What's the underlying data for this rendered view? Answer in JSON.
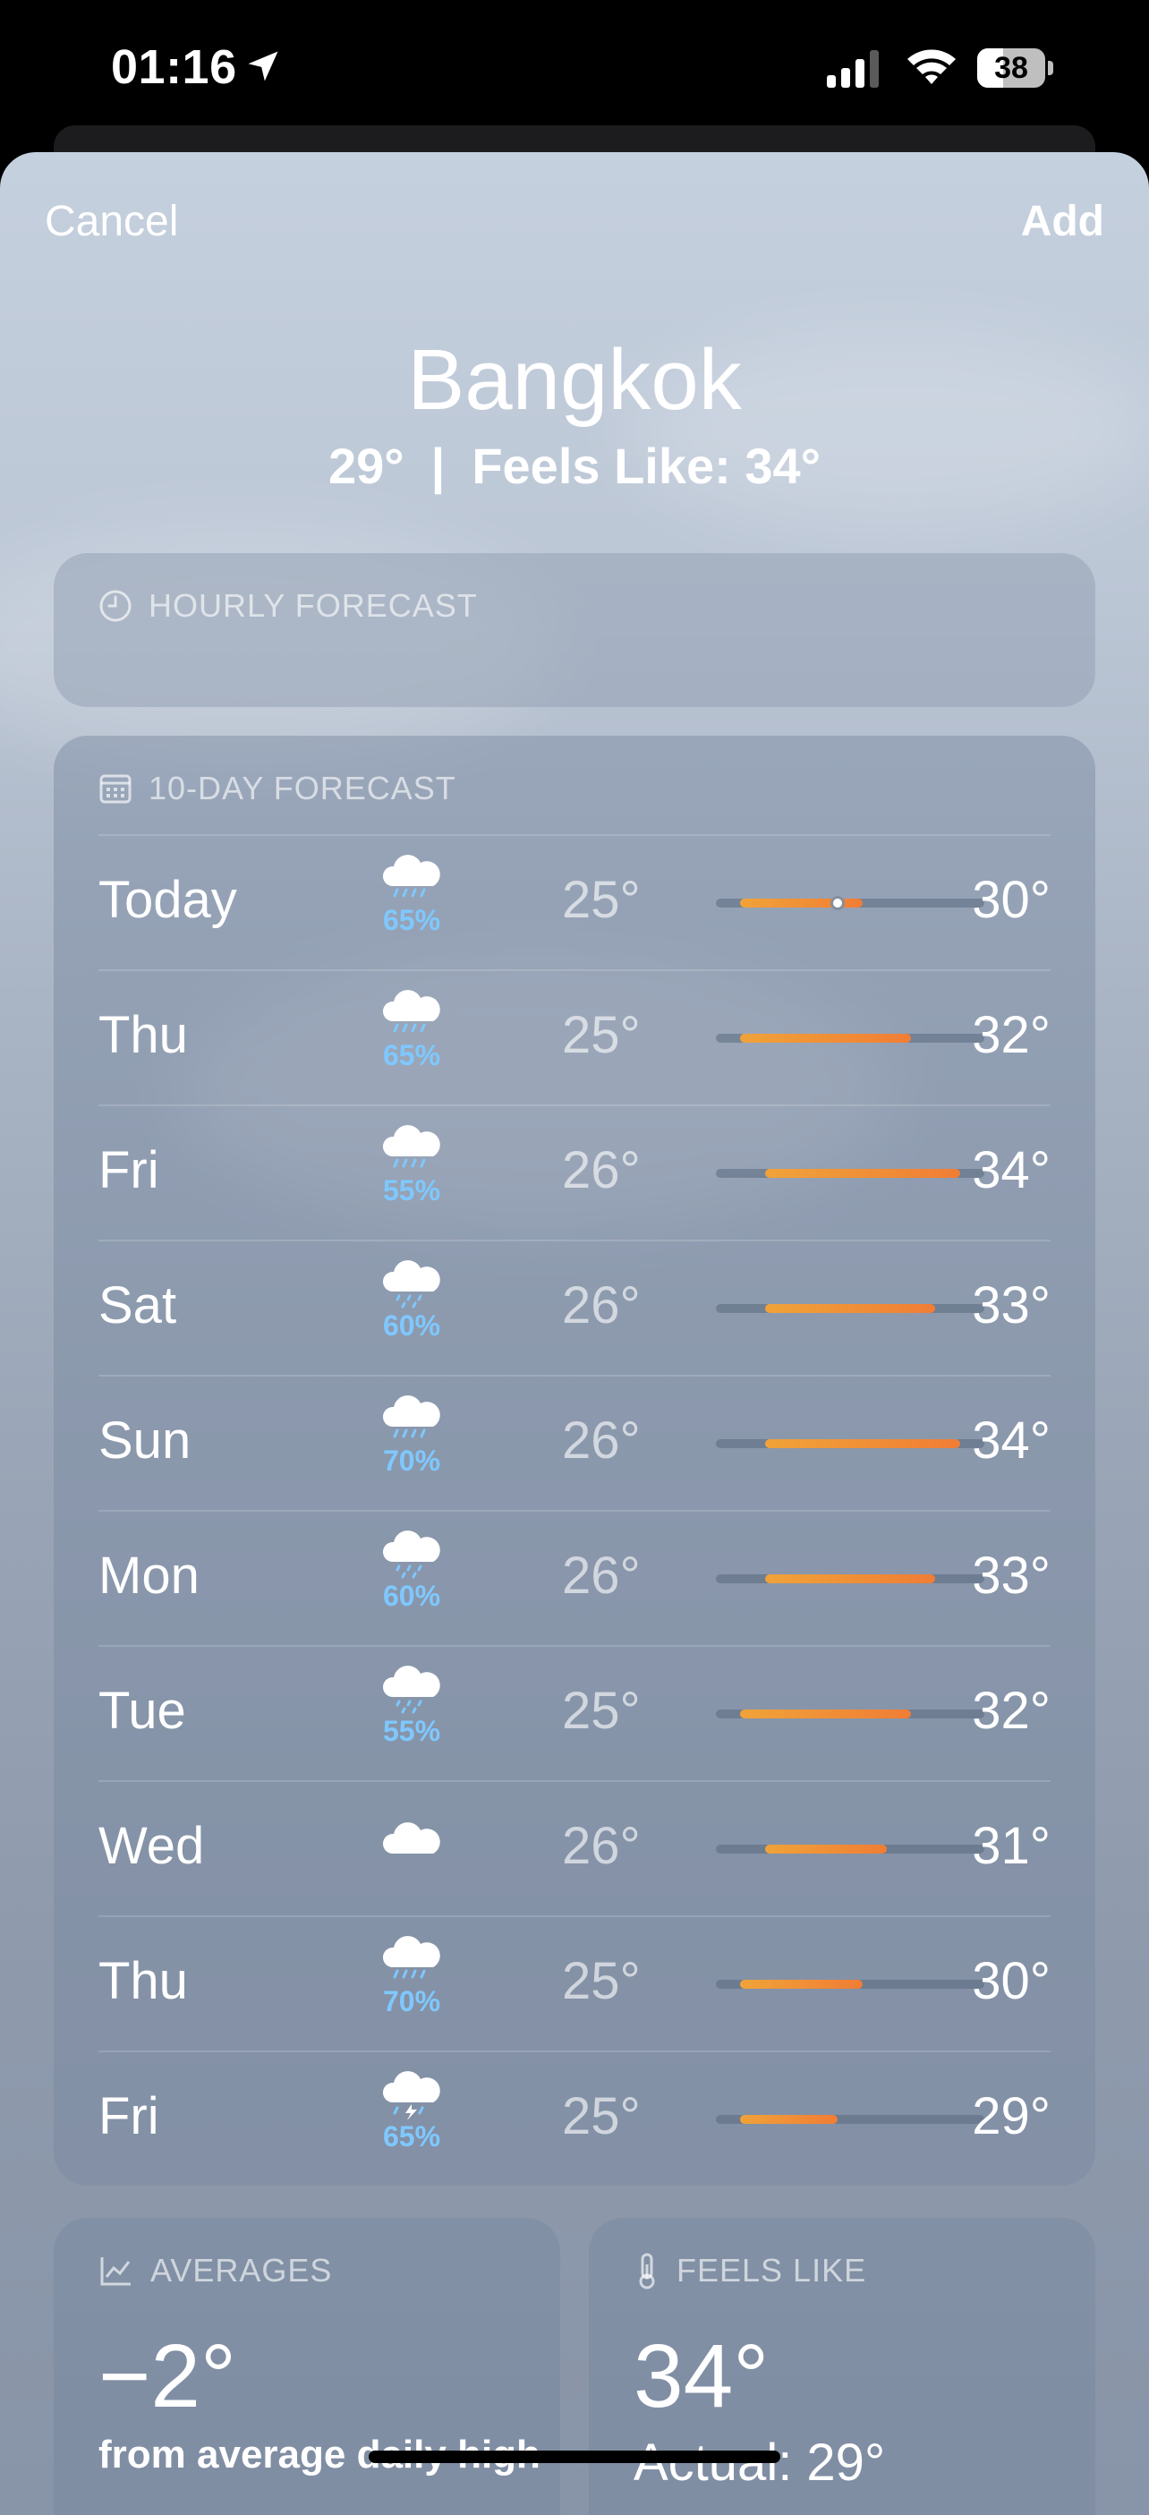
{
  "status": {
    "time": "01:16",
    "battery": "38",
    "battery_level": 0.38
  },
  "nav": {
    "cancel": "Cancel",
    "add": "Add"
  },
  "location": {
    "city": "Bangkok",
    "current_temp": "29°",
    "separator": "|",
    "feels_like": "Feels Like: 34°"
  },
  "hourly": {
    "title": "HOURLY FORECAST",
    "icon": "clock-icon"
  },
  "tenday": {
    "title": "10-DAY FORECAST",
    "icon": "calendar-icon",
    "range_min": 24,
    "range_max": 35,
    "days": [
      {
        "day": "Today",
        "icon": "cloud-rain-icon",
        "precip": "65%",
        "low": "25°",
        "high": "30°",
        "low_val": 25,
        "high_val": 30,
        "current": 29
      },
      {
        "day": "Thu",
        "icon": "cloud-rain-icon",
        "precip": "65%",
        "low": "25°",
        "high": "32°",
        "low_val": 25,
        "high_val": 32
      },
      {
        "day": "Fri",
        "icon": "cloud-rain-icon",
        "precip": "55%",
        "low": "26°",
        "high": "34°",
        "low_val": 26,
        "high_val": 34
      },
      {
        "day": "Sat",
        "icon": "cloud-drizzle-icon",
        "precip": "60%",
        "low": "26°",
        "high": "33°",
        "low_val": 26,
        "high_val": 33
      },
      {
        "day": "Sun",
        "icon": "cloud-rain-icon",
        "precip": "70%",
        "low": "26°",
        "high": "34°",
        "low_val": 26,
        "high_val": 34
      },
      {
        "day": "Mon",
        "icon": "cloud-drizzle-icon",
        "precip": "60%",
        "low": "26°",
        "high": "33°",
        "low_val": 26,
        "high_val": 33
      },
      {
        "day": "Tue",
        "icon": "cloud-drizzle-icon",
        "precip": "55%",
        "low": "25°",
        "high": "32°",
        "low_val": 25,
        "high_val": 32
      },
      {
        "day": "Wed",
        "icon": "cloud-icon",
        "precip": "",
        "low": "26°",
        "high": "31°",
        "low_val": 26,
        "high_val": 31
      },
      {
        "day": "Thu",
        "icon": "cloud-rain-icon",
        "precip": "70%",
        "low": "25°",
        "high": "30°",
        "low_val": 25,
        "high_val": 30
      },
      {
        "day": "Fri",
        "icon": "cloud-bolt-rain-icon",
        "precip": "65%",
        "low": "25°",
        "high": "29°",
        "low_val": 25,
        "high_val": 29
      }
    ]
  },
  "averages": {
    "title": "AVERAGES",
    "icon": "chart-trend-icon",
    "value": "−2°",
    "text": "from average daily high"
  },
  "feels_like": {
    "title": "FEELS LIKE",
    "icon": "thermometer-icon",
    "value": "34°",
    "actual": "Actual: 29°"
  }
}
